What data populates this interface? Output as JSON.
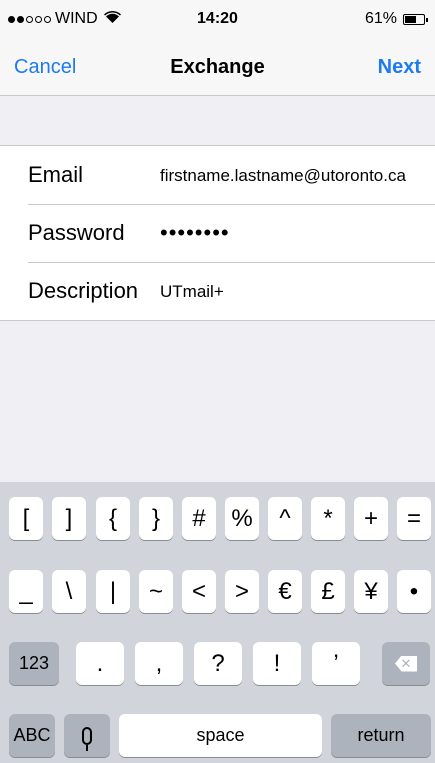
{
  "status_bar": {
    "carrier": "WIND",
    "time": "14:20",
    "battery": "61%",
    "battery_level": 0.61,
    "signal_full": 2,
    "signal_total": 5
  },
  "nav": {
    "cancel": "Cancel",
    "title": "Exchange",
    "next": "Next",
    "accent_color": "#1d7bf0"
  },
  "form": {
    "email_label": "Email",
    "email_value": "firstname.lastname@utoronto.ca",
    "password_label": "Password",
    "password_value": "••••••••",
    "description_label": "Description",
    "description_value": "UTmail+"
  },
  "keyboard": {
    "row1": [
      "[",
      "]",
      "{",
      "}",
      "#",
      "%",
      "^",
      "*",
      "+",
      "="
    ],
    "row2": [
      "_",
      "\\",
      "|",
      "~",
      "<",
      ">",
      "€",
      "£",
      "¥",
      "•"
    ],
    "row3_left": "123",
    "row3": [
      ".",
      ",",
      "?",
      "!",
      "’"
    ],
    "row4_left": "ABC",
    "space": "space",
    "return": "return",
    "icons": {
      "backspace": "backspace-icon",
      "mic": "microphone-icon"
    }
  }
}
